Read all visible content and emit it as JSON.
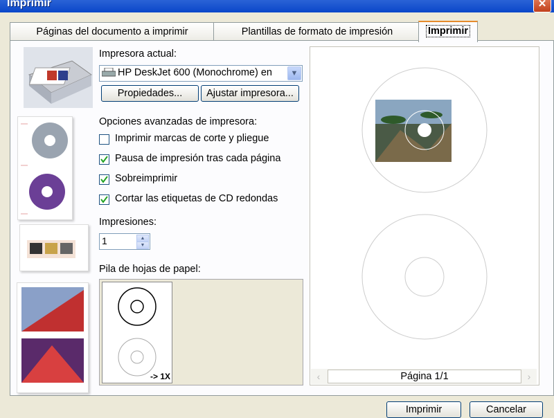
{
  "window": {
    "title": "Imprimir",
    "close_icon": "close-icon"
  },
  "tabs": [
    {
      "label": "Páginas del documento a imprimir",
      "active": false
    },
    {
      "label": "Plantillas de formato de impresión",
      "active": false
    },
    {
      "label": "Imprimir",
      "active": true
    }
  ],
  "printer": {
    "label": "Impresora actual:",
    "value": "HP DeskJet 600 (Monochrome) en",
    "properties_button": "Propiedades...",
    "adjust_button": "Ajustar impresora..."
  },
  "advanced": {
    "label": "Opciones avanzadas de impresora:",
    "options": [
      {
        "label": "Imprimir marcas de corte y pliegue",
        "checked": false
      },
      {
        "label": "Pausa de impresión tras cada página",
        "checked": true
      },
      {
        "label": "Sobreimprimir",
        "checked": true
      },
      {
        "label": "Cortar las etiquetas de CD redondas",
        "checked": true
      }
    ]
  },
  "copies": {
    "label": "Impresiones:",
    "value": "1"
  },
  "paper_stack": {
    "label": "Pila de hojas de papel:",
    "count": "-> 1X"
  },
  "preview": {
    "page_indicator": "Página 1/1"
  },
  "footer": {
    "print_button": "Imprimir",
    "cancel_button": "Cancelar"
  }
}
